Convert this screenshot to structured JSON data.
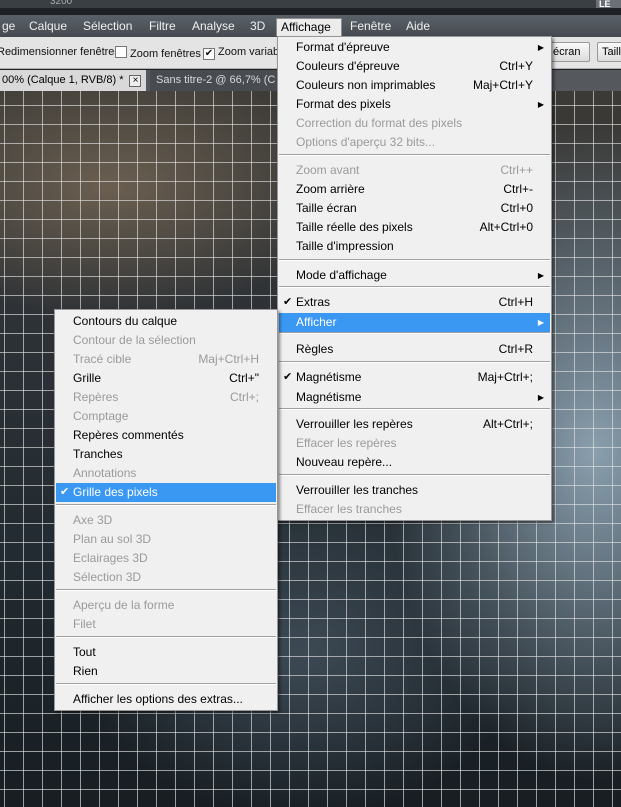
{
  "menubar": {
    "items": [
      {
        "label": "ge",
        "name": "menu-image"
      },
      {
        "label": "Calque",
        "name": "menu-calque"
      },
      {
        "label": "Sélection",
        "name": "menu-selection"
      },
      {
        "label": "Filtre",
        "name": "menu-filtre"
      },
      {
        "label": "Analyse",
        "name": "menu-analyse"
      },
      {
        "label": "3D",
        "name": "menu-3d"
      },
      {
        "label": "Affichage",
        "name": "menu-affichage"
      },
      {
        "label": "Fenêtre",
        "name": "menu-fenetre"
      },
      {
        "label": "Aide",
        "name": "menu-aide"
      }
    ],
    "workspace_badge": "LE"
  },
  "options_bar": {
    "resize_windows": "Redimensionner fenêtres",
    "zoom_windows": "Zoom fenêtres",
    "zoom_variable": "Zoom variable",
    "btn_screen": "écran",
    "btn_print": "Taill"
  },
  "tabs": {
    "active": "00% (Calque 1, RVB/8) *",
    "active_close": "×",
    "inactive": "Sans titre-2 @ 66,7% (C"
  },
  "affichage_menu": {
    "groups": [
      [
        {
          "label": "Format d'épreuve",
          "sub": true
        },
        {
          "label": "Couleurs d'épreuve",
          "shortcut": "Ctrl+Y"
        },
        {
          "label": "Couleurs non imprimables",
          "shortcut": "Maj+Ctrl+Y"
        },
        {
          "label": "Format des pixels",
          "sub": true
        },
        {
          "label": "Correction du format des pixels",
          "disabled": true
        },
        {
          "label": "Options d'aperçu 32 bits...",
          "disabled": true
        }
      ],
      [
        {
          "label": "Zoom avant",
          "shortcut": "Ctrl++",
          "disabled": true
        },
        {
          "label": "Zoom arrière",
          "shortcut": "Ctrl+-"
        },
        {
          "label": "Taille écran",
          "shortcut": "Ctrl+0"
        },
        {
          "label": "Taille réelle des pixels",
          "shortcut": "Alt+Ctrl+0"
        },
        {
          "label": "Taille d'impression"
        }
      ],
      [
        {
          "label": "Mode d'affichage",
          "sub": true
        }
      ],
      [
        {
          "label": "Extras",
          "shortcut": "Ctrl+H",
          "checked": true
        },
        {
          "label": "Afficher",
          "sub": true,
          "highlighted": true
        }
      ],
      [
        {
          "label": "Règles",
          "shortcut": "Ctrl+R"
        }
      ],
      [
        {
          "label": "Magnétisme",
          "shortcut": "Maj+Ctrl+;",
          "checked": true
        },
        {
          "label": "Magnétisme",
          "sub": true
        }
      ],
      [
        {
          "label": "Verrouiller les repères",
          "shortcut": "Alt+Ctrl+;"
        },
        {
          "label": "Effacer les repères",
          "disabled": true
        },
        {
          "label": "Nouveau repère..."
        }
      ],
      [
        {
          "label": "Verrouiller les tranches"
        },
        {
          "label": "Effacer les tranches",
          "disabled": true
        }
      ]
    ]
  },
  "afficher_menu": {
    "groups": [
      [
        {
          "label": "Contours du calque"
        },
        {
          "label": "Contour de la sélection",
          "disabled": true
        },
        {
          "label": "Tracé cible",
          "shortcut": "Maj+Ctrl+H",
          "disabled": true
        },
        {
          "label": "Grille",
          "shortcut": "Ctrl+\""
        },
        {
          "label": "Repères",
          "shortcut": "Ctrl+;",
          "disabled": true
        },
        {
          "label": "Comptage",
          "disabled": true
        },
        {
          "label": "Repères commentés"
        },
        {
          "label": "Tranches"
        },
        {
          "label": "Annotations",
          "disabled": true
        },
        {
          "label": "Grille des pixels",
          "checked": true,
          "highlighted": true
        }
      ],
      [
        {
          "label": "Axe 3D",
          "disabled": true
        },
        {
          "label": "Plan au sol 3D",
          "disabled": true
        },
        {
          "label": "Eclairages 3D",
          "disabled": true
        },
        {
          "label": "Sélection 3D",
          "disabled": true
        }
      ],
      [
        {
          "label": "Aperçu de la forme",
          "disabled": true
        },
        {
          "label": "Filet",
          "disabled": true
        }
      ],
      [
        {
          "label": "Tout"
        },
        {
          "label": "Rien"
        }
      ],
      [
        {
          "label": "Afficher les options des extras..."
        }
      ]
    ]
  },
  "icons": {
    "check": "✔",
    "submenu_arrow": "▶",
    "close": "×"
  }
}
